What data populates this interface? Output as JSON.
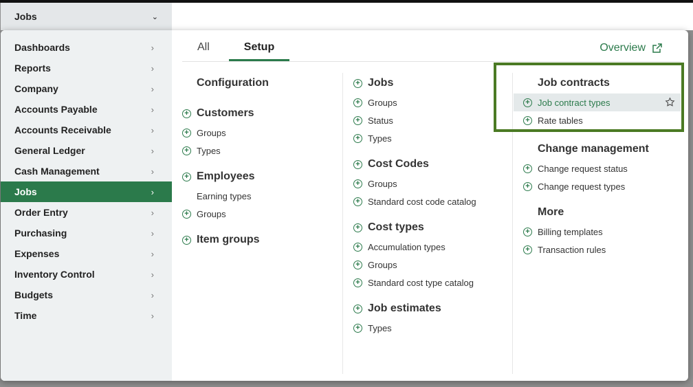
{
  "module": {
    "label": "Jobs"
  },
  "sidebar": {
    "items": [
      {
        "label": "Dashboards"
      },
      {
        "label": "Reports"
      },
      {
        "label": "Company"
      },
      {
        "label": "Accounts Payable"
      },
      {
        "label": "Accounts Receivable"
      },
      {
        "label": "General Ledger"
      },
      {
        "label": "Cash Management"
      },
      {
        "label": "Jobs",
        "active": true
      },
      {
        "label": "Order Entry"
      },
      {
        "label": "Purchasing"
      },
      {
        "label": "Expenses"
      },
      {
        "label": "Inventory Control"
      },
      {
        "label": "Budgets"
      },
      {
        "label": "Time"
      }
    ]
  },
  "tabs": {
    "all": "All",
    "setup": "Setup"
  },
  "overview": {
    "label": "Overview"
  },
  "col1": {
    "configuration": "Configuration",
    "customers": "Customers",
    "customers_groups": "Groups",
    "customers_types": "Types",
    "employees": "Employees",
    "employees_earning_types": "Earning types",
    "employees_groups": "Groups",
    "item_groups": "Item groups"
  },
  "col2": {
    "jobs": "Jobs",
    "jobs_groups": "Groups",
    "jobs_status": "Status",
    "jobs_types": "Types",
    "cost_codes": "Cost Codes",
    "cost_codes_groups": "Groups",
    "cost_codes_catalog": "Standard cost code catalog",
    "cost_types": "Cost types",
    "cost_types_accumulation": "Accumulation types",
    "cost_types_groups": "Groups",
    "cost_types_catalog": "Standard cost type catalog",
    "job_estimates": "Job estimates",
    "job_estimates_types": "Types"
  },
  "col3": {
    "job_contracts": "Job contracts",
    "job_contract_types": "Job contract types",
    "rate_tables": "Rate tables",
    "change_management": "Change management",
    "change_request_status": "Change request status",
    "change_request_types": "Change request types",
    "more": "More",
    "billing_templates": "Billing templates",
    "transaction_rules": "Transaction rules"
  },
  "colors": {
    "accent": "#2b7a4b",
    "highlight": "#4b7a24"
  }
}
